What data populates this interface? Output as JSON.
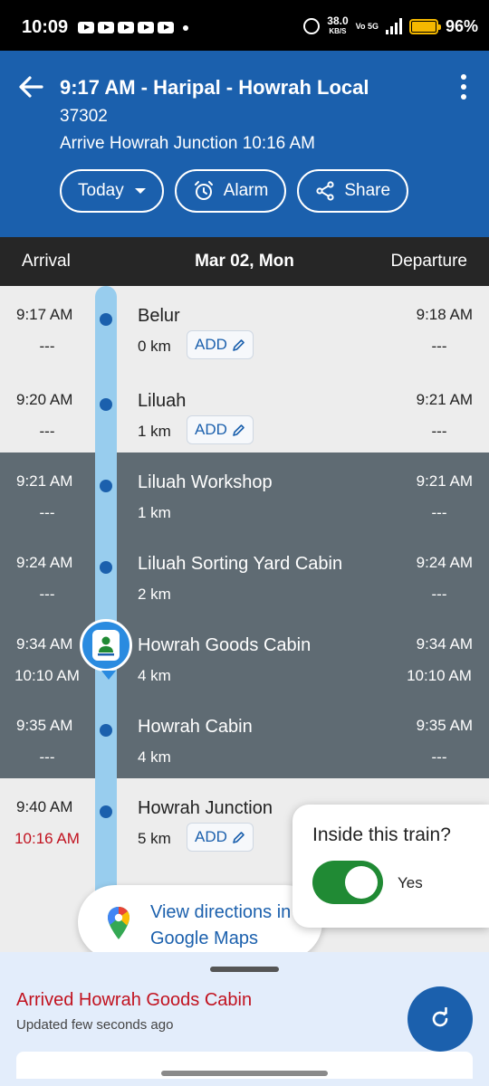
{
  "statusbar": {
    "time": "10:09",
    "speed": "38.0",
    "speed_unit": "KB/S",
    "network": "Vo 5G",
    "battery": "96%"
  },
  "header": {
    "title": "9:17 AM - Haripal - Howrah Local",
    "train_number": "37302",
    "arrive": "Arrive Howrah Junction 10:16 AM",
    "buttons": {
      "today": "Today",
      "alarm": "Alarm",
      "share": "Share"
    }
  },
  "datebar": {
    "arrival": "Arrival",
    "date": "Mar 02, Mon",
    "departure": "Departure"
  },
  "stations": [
    {
      "name": "Belur",
      "km": "0 km",
      "arr": "9:17 AM",
      "arr_actual": "---",
      "dep": "9:18 AM",
      "dep_actual": "---",
      "add": "ADD"
    },
    {
      "name": "Liluah",
      "km": "1 km",
      "arr": "9:20 AM",
      "arr_actual": "---",
      "dep": "9:21 AM",
      "dep_actual": "---",
      "add": "ADD"
    },
    {
      "name": "Liluah Workshop",
      "km": "1 km",
      "arr": "9:21 AM",
      "arr_actual": "---",
      "dep": "9:21 AM",
      "dep_actual": "---"
    },
    {
      "name": "Liluah Sorting Yard Cabin",
      "km": "2 km",
      "arr": "9:24 AM",
      "arr_actual": "---",
      "dep": "9:24 AM",
      "dep_actual": "---"
    },
    {
      "name": "Howrah Goods Cabin",
      "km": "4 km",
      "arr": "9:34 AM",
      "arr_actual": "10:10 AM",
      "dep": "9:34 AM",
      "dep_actual": "10:10 AM"
    },
    {
      "name": "Howrah Cabin",
      "km": "4 km",
      "arr": "9:35 AM",
      "arr_actual": "---",
      "dep": "9:35 AM",
      "dep_actual": "---"
    },
    {
      "name": "Howrah Junction",
      "km": "5 km",
      "arr": "9:40 AM",
      "arr_actual": "10:16 AM",
      "add": "ADD"
    }
  ],
  "maps_card": {
    "text": "View directions in Google Maps"
  },
  "inside_card": {
    "question": "Inside this train?",
    "toggle_label": "Yes",
    "toggle_on": true
  },
  "sheet": {
    "status": "Arrived Howrah Goods Cabin",
    "updated": "Updated few seconds ago"
  },
  "colors": {
    "primary": "#1b60ad",
    "late": "#c1121f",
    "toggle_on": "#208a34",
    "passed_band": "#5f6b73"
  }
}
